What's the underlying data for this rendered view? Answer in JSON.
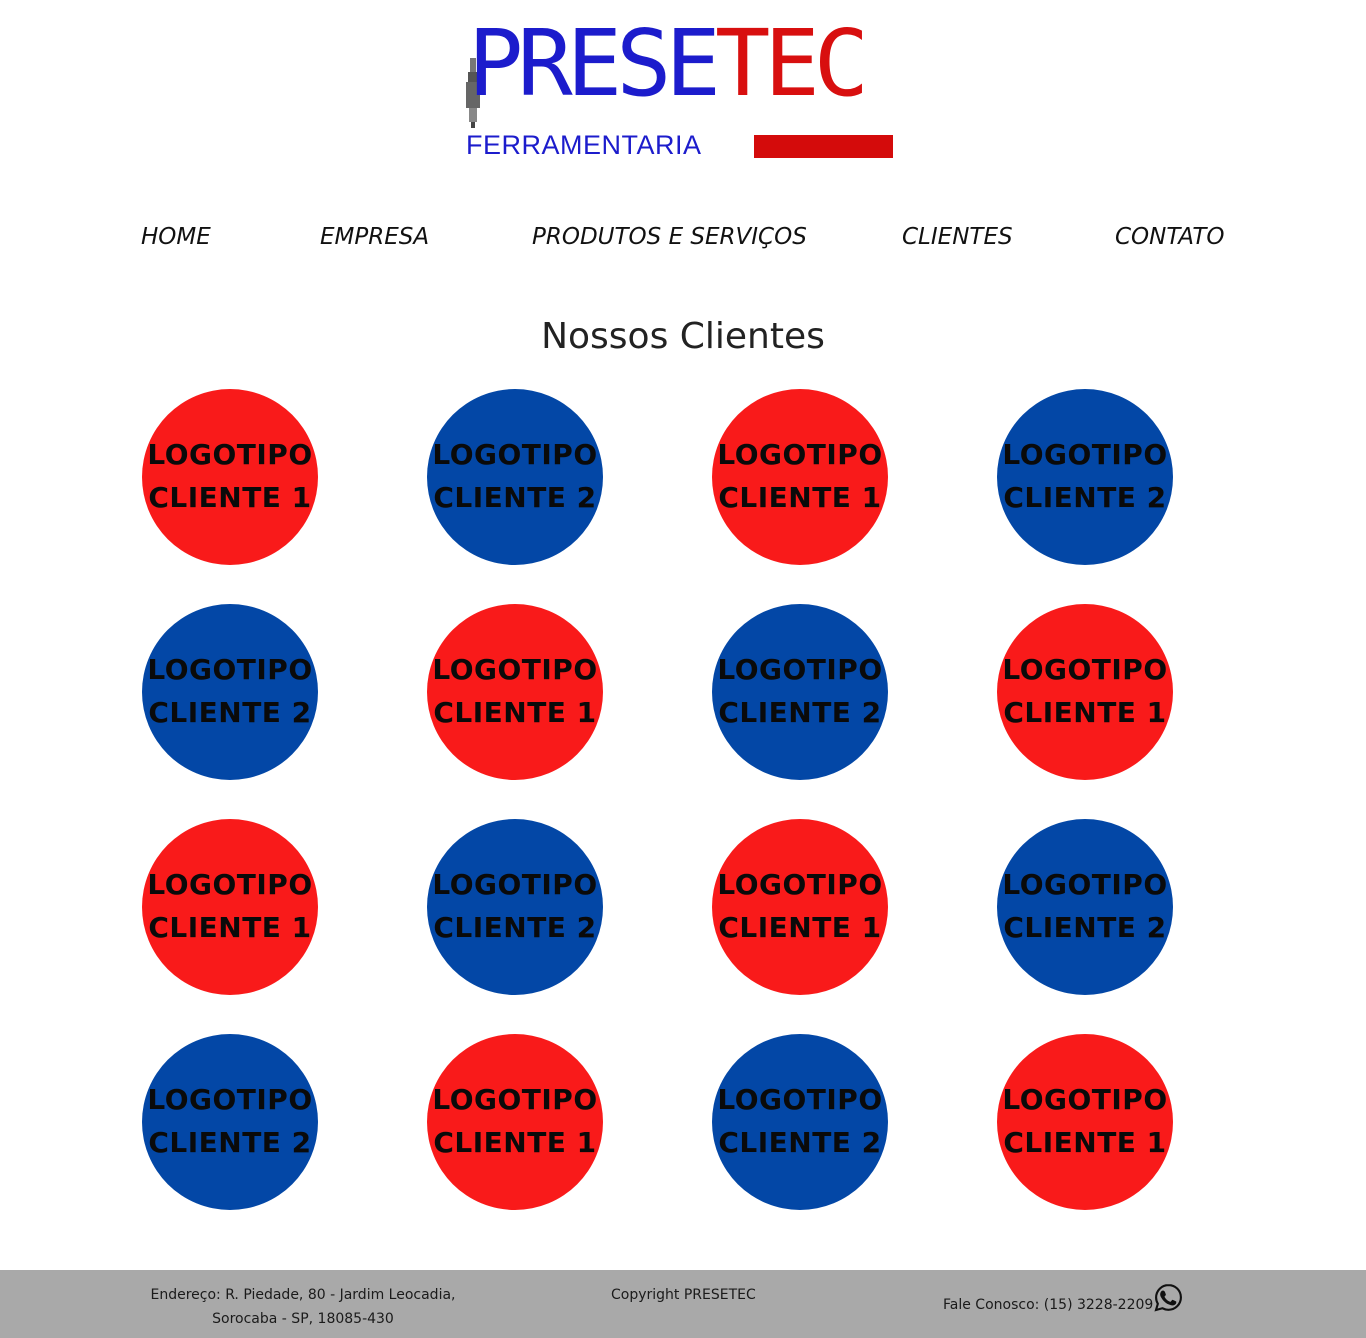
{
  "brand": {
    "name_part1": "PRESE",
    "name_part2": "TEC",
    "subtitle": "FERRAMENTARIA",
    "colors": {
      "blue": "#1c1ccc",
      "red": "#d40b0b"
    }
  },
  "nav": {
    "items": [
      {
        "label": "HOME"
      },
      {
        "label": "EMPRESA"
      },
      {
        "label": "PRODUTOS E SERVIÇOS"
      },
      {
        "label": "CLIENTES"
      },
      {
        "label": "CONTATO"
      }
    ]
  },
  "main": {
    "title": "Nossos Clientes",
    "clients": [
      {
        "line1": "LOGOTIPO",
        "line2": "CLIENTE 1",
        "color": "#f91a1a"
      },
      {
        "line1": "LOGOTIPO",
        "line2": "CLIENTE 2",
        "color": "#0347a6"
      },
      {
        "line1": "LOGOTIPO",
        "line2": "CLIENTE 1",
        "color": "#f91a1a"
      },
      {
        "line1": "LOGOTIPO",
        "line2": "CLIENTE 2",
        "color": "#0347a6"
      },
      {
        "line1": "LOGOTIPO",
        "line2": "CLIENTE 2",
        "color": "#0347a6"
      },
      {
        "line1": "LOGOTIPO",
        "line2": "CLIENTE 1",
        "color": "#f91a1a"
      },
      {
        "line1": "LOGOTIPO",
        "line2": "CLIENTE 2",
        "color": "#0347a6"
      },
      {
        "line1": "LOGOTIPO",
        "line2": "CLIENTE 1",
        "color": "#f91a1a"
      },
      {
        "line1": "LOGOTIPO",
        "line2": "CLIENTE 1",
        "color": "#f91a1a"
      },
      {
        "line1": "LOGOTIPO",
        "line2": "CLIENTE 2",
        "color": "#0347a6"
      },
      {
        "line1": "LOGOTIPO",
        "line2": "CLIENTE 1",
        "color": "#f91a1a"
      },
      {
        "line1": "LOGOTIPO",
        "line2": "CLIENTE 2",
        "color": "#0347a6"
      },
      {
        "line1": "LOGOTIPO",
        "line2": "CLIENTE 2",
        "color": "#0347a6"
      },
      {
        "line1": "LOGOTIPO",
        "line2": "CLIENTE 1",
        "color": "#f91a1a"
      },
      {
        "line1": "LOGOTIPO",
        "line2": "CLIENTE 2",
        "color": "#0347a6"
      },
      {
        "line1": "LOGOTIPO",
        "line2": "CLIENTE 1",
        "color": "#f91a1a"
      }
    ]
  },
  "footer": {
    "address_line1": "Endereço: R. Piedade, 80 - Jardim Leocadia,",
    "address_line2": "Sorocaba - SP, 18085-430",
    "copyright": "Copyright PRESETEC",
    "contact": "Fale Conosco: (15) 3228-2209",
    "contact_icon": "whatsapp-icon",
    "background": "#a9a9a9"
  }
}
